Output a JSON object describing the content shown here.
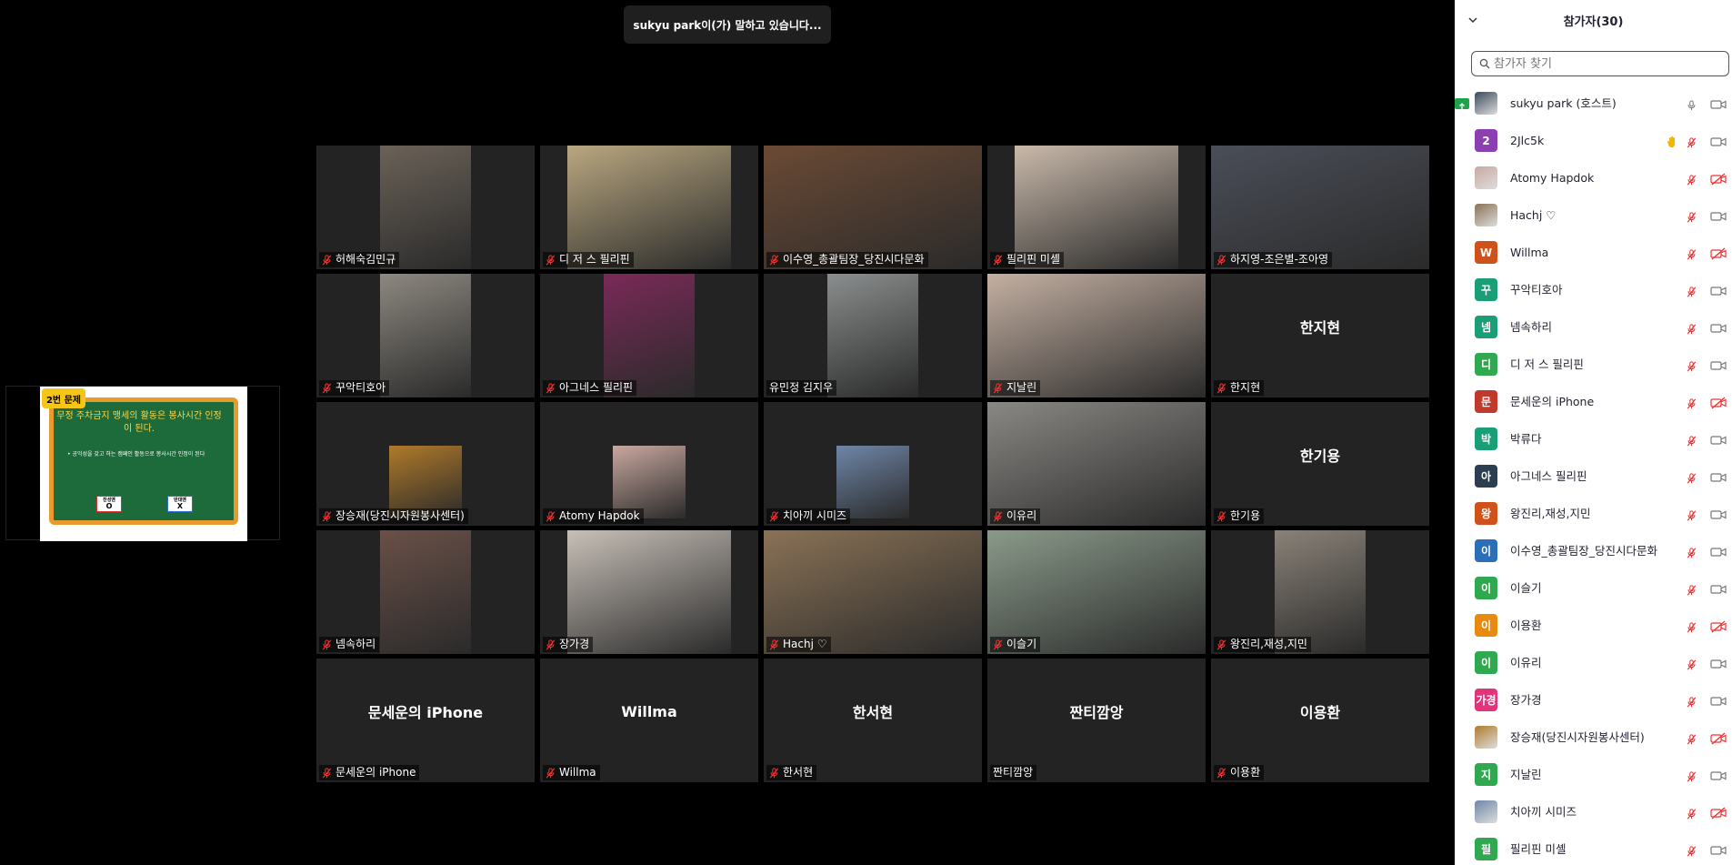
{
  "speaking_banner": "sukyu park이(가) 말하고 있습니다...",
  "shared_screen": {
    "tag": "2번 문제",
    "question": "무정 주차금지 맹세의 활동은 봉사시간 인정이 된다.",
    "subtext": "• 공익성을 갖고 하는 캠페인 활동으로 봉사시간 인정이 된다",
    "sign_o_label": "찬성맨",
    "sign_o": "O",
    "sign_x_label": "반대맨",
    "sign_x": "X"
  },
  "tiles": [
    {
      "name": "허해숙김민규",
      "muted": true,
      "video": "narrow",
      "color": "#6b6258"
    },
    {
      "name": "디 저 스 필리핀",
      "muted": true,
      "video": "medium",
      "color": "#b9a780"
    },
    {
      "name": "이수영_총괄팀장_당진시다문화",
      "muted": true,
      "video": "full",
      "color": "#6b4a35"
    },
    {
      "name": "필리핀 미셸",
      "muted": true,
      "video": "medium",
      "color": "#c9b9aa"
    },
    {
      "name": "하지영-조은별-조아영",
      "muted": true,
      "video": "full",
      "color": "#4a4e58"
    },
    {
      "name": "꾸악티호아",
      "muted": true,
      "video": "narrow",
      "color": "#8d8880"
    },
    {
      "name": "아그네스 필리핀",
      "muted": true,
      "video": "narrow",
      "color": "#7a2a58"
    },
    {
      "name": "유민정 김지우",
      "muted": false,
      "video": "narrow",
      "color": "#8b8e8e"
    },
    {
      "name": "지날린",
      "muted": true,
      "video": "full",
      "color": "#c4b0a2"
    },
    {
      "name": "한지현",
      "muted": true,
      "video": "none",
      "display": "한지현"
    },
    {
      "name": "장승재(당진시자원봉사센터)",
      "muted": true,
      "video": "square",
      "color": "#b07a2a"
    },
    {
      "name": "Atomy Hapdok",
      "muted": true,
      "video": "square",
      "color": "#c9a8a0"
    },
    {
      "name": "치아끼 시미즈",
      "muted": true,
      "video": "square",
      "color": "#6f86a8"
    },
    {
      "name": "이유리",
      "muted": true,
      "video": "full",
      "color": "#8a8884"
    },
    {
      "name": "한기용",
      "muted": true,
      "video": "none",
      "display": "한기용"
    },
    {
      "name": "넴속하리",
      "muted": true,
      "video": "narrow",
      "color": "#6a5048"
    },
    {
      "name": "장가경",
      "muted": true,
      "video": "medium",
      "color": "#c8c0b8"
    },
    {
      "name": "Hachj ♡",
      "muted": true,
      "video": "full",
      "color": "#8a7256"
    },
    {
      "name": "이슬기",
      "muted": true,
      "video": "full",
      "color": "#8a9a8a"
    },
    {
      "name": "왕진리,재성,지민",
      "muted": true,
      "video": "narrow",
      "color": "#8a8278"
    },
    {
      "name": "문세운의 iPhone",
      "muted": true,
      "video": "none",
      "display": "문세운의 iPhone"
    },
    {
      "name": "Willma",
      "muted": true,
      "video": "none",
      "display": "Willma"
    },
    {
      "name": "한서현",
      "muted": true,
      "video": "none",
      "display": "한서현"
    },
    {
      "name": "짠티깜앙",
      "muted": false,
      "video": "none",
      "display": "짠티깜앙"
    },
    {
      "name": "이용환",
      "muted": true,
      "video": "none",
      "display": "이용환"
    }
  ],
  "panel": {
    "title": "참가자(30)",
    "search_placeholder": "참가자 찾기",
    "participants": [
      {
        "name": "sukyu park (호스트)",
        "avatar": "",
        "avatar_color": "#3a4a5a",
        "photo": true,
        "mic": "on",
        "cam": "off",
        "share": true
      },
      {
        "name": "2Jlc5k",
        "avatar": "2",
        "avatar_color": "#8b3fb0",
        "mic": "muted",
        "cam": "off",
        "hand": true
      },
      {
        "name": "Atomy Hapdok",
        "avatar": "",
        "avatar_color": "#c9a8a0",
        "photo": true,
        "mic": "muted",
        "cam": "muted"
      },
      {
        "name": "Hachj ♡",
        "avatar": "",
        "avatar_color": "#8a7256",
        "photo": true,
        "mic": "muted",
        "cam": "off"
      },
      {
        "name": "Willma",
        "avatar": "W",
        "avatar_color": "#d0521b",
        "mic": "muted",
        "cam": "muted"
      },
      {
        "name": "꾸악티호아",
        "avatar": "꾸",
        "avatar_color": "#1a9e77",
        "mic": "muted",
        "cam": "off"
      },
      {
        "name": "넴속하리",
        "avatar": "넴",
        "avatar_color": "#1a9e77",
        "mic": "muted",
        "cam": "off"
      },
      {
        "name": "디 저 스 필리핀",
        "avatar": "디",
        "avatar_color": "#2fa84f",
        "mic": "muted",
        "cam": "off"
      },
      {
        "name": "문세운의 iPhone",
        "avatar": "문",
        "avatar_color": "#c0392b",
        "mic": "muted",
        "cam": "muted"
      },
      {
        "name": "박류다",
        "avatar": "박",
        "avatar_color": "#1a9e77",
        "mic": "muted",
        "cam": "off"
      },
      {
        "name": "아그네스 필리핀",
        "avatar": "아",
        "avatar_color": "#2c3e50",
        "mic": "muted",
        "cam": "off"
      },
      {
        "name": "왕진리,재성,지민",
        "avatar": "왕",
        "avatar_color": "#d0521b",
        "mic": "muted",
        "cam": "off"
      },
      {
        "name": "이수영_총괄팀장_당진시다문화",
        "avatar": "이",
        "avatar_color": "#2a6fb8",
        "mic": "muted",
        "cam": "off"
      },
      {
        "name": "이슬기",
        "avatar": "이",
        "avatar_color": "#2fa84f",
        "mic": "muted",
        "cam": "off"
      },
      {
        "name": "이용환",
        "avatar": "이",
        "avatar_color": "#e88a10",
        "mic": "muted",
        "cam": "muted"
      },
      {
        "name": "이유리",
        "avatar": "이",
        "avatar_color": "#2fa84f",
        "mic": "muted",
        "cam": "off"
      },
      {
        "name": "장가경",
        "avatar": "가경",
        "avatar_color": "#e0357a",
        "mic": "muted",
        "cam": "off"
      },
      {
        "name": "장승재(당진시자원봉사센터)",
        "avatar": "",
        "avatar_color": "#b07a2a",
        "photo": true,
        "mic": "muted",
        "cam": "muted"
      },
      {
        "name": "지날린",
        "avatar": "지",
        "avatar_color": "#2fa84f",
        "mic": "muted",
        "cam": "off"
      },
      {
        "name": "치아끼 시미즈",
        "avatar": "",
        "avatar_color": "#6f86a8",
        "photo": true,
        "mic": "muted",
        "cam": "muted"
      },
      {
        "name": "필리핀 미셸",
        "avatar": "필",
        "avatar_color": "#2fa84f",
        "mic": "muted",
        "cam": "off"
      }
    ]
  }
}
